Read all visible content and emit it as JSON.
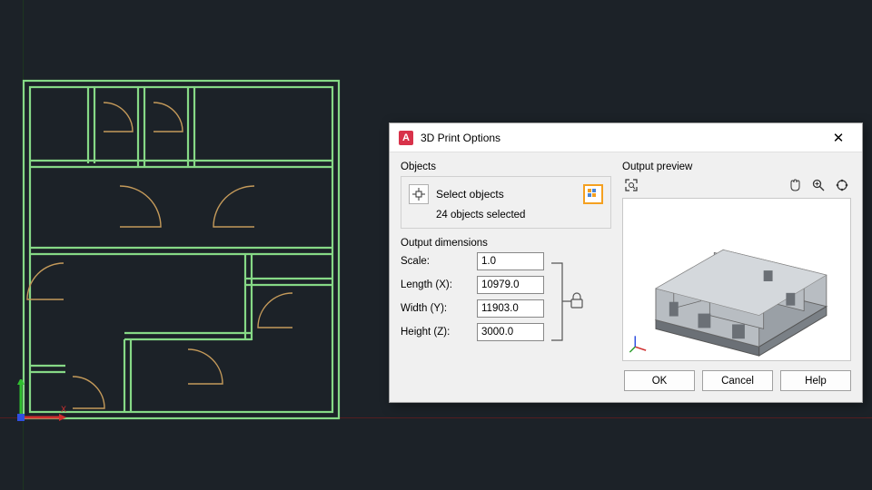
{
  "dialog": {
    "title": "3D Print Options",
    "objects_section_label": "Objects",
    "select_objects_label": "Select objects",
    "objects_selected_text": "24 objects selected",
    "output_dimensions_label": "Output dimensions",
    "scale_label": "Scale:",
    "length_label": "Length (X):",
    "width_label": "Width (Y):",
    "height_label": "Height (Z):",
    "scale_value": "1.0",
    "length_value": "10979.0",
    "width_value": "11903.0",
    "height_value": "3000.0",
    "output_preview_label": "Output preview",
    "btn_ok": "OK",
    "btn_cancel": "Cancel",
    "btn_help": "Help"
  }
}
